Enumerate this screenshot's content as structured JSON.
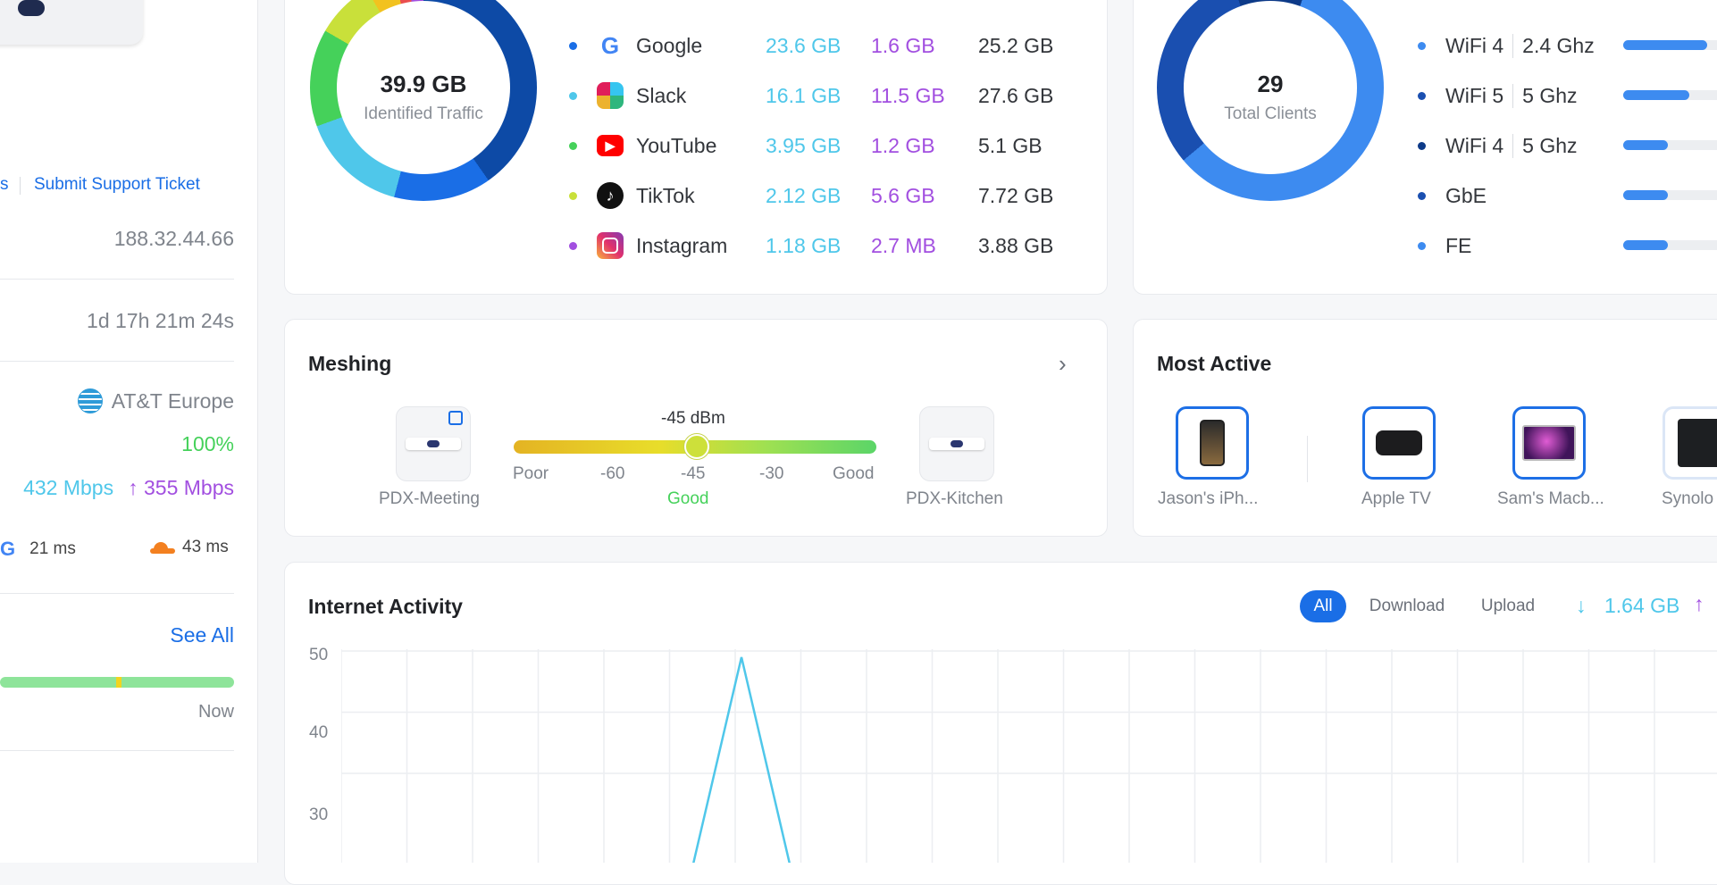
{
  "sidebar": {
    "links": {
      "fragment": "s",
      "support": "Submit Support Ticket"
    },
    "ip": "188.32.44.66",
    "uptime": "1d 17h 21m 24s",
    "isp": "AT&T Europe",
    "health": "100%",
    "download": "432 Mbps",
    "upload": "355 Mbps",
    "latency_google": "21 ms",
    "latency_cloudflare": "43 ms",
    "see_all": "See All",
    "timeline_end": "Now",
    "colors": {
      "link": "#1a6ee6",
      "health": "#45d15a",
      "download": "#4fc7ea",
      "upload": "#a24fe0"
    }
  },
  "apps": {
    "donut_value": "39.9 GB",
    "donut_caption": "Identified Traffic",
    "rows": [
      {
        "name": "Google",
        "down": "23.6 GB",
        "up": "1.6 GB",
        "total": "25.2 GB",
        "dot": "#1a6ee6",
        "icon": "google-icon"
      },
      {
        "name": "Slack",
        "down": "16.1 GB",
        "up": "11.5 GB",
        "total": "27.6 GB",
        "dot": "#4fc7ea",
        "icon": "slack-icon"
      },
      {
        "name": "YouTube",
        "down": "3.95 GB",
        "up": "1.2 GB",
        "total": "5.1 GB",
        "dot": "#45d15a",
        "icon": "youtube-icon"
      },
      {
        "name": "TikTok",
        "down": "2.12 GB",
        "up": "5.6 GB",
        "total": "7.72 GB",
        "dot": "#c9e03a",
        "icon": "tiktok-icon"
      },
      {
        "name": "Instagram",
        "down": "1.18 GB",
        "up": "2.7 MB",
        "total": "3.88 GB",
        "dot": "#a24fe0",
        "icon": "instagram-icon"
      }
    ]
  },
  "clients": {
    "donut_value": "29",
    "donut_caption": "Total Clients",
    "rows": [
      {
        "type": "WiFi 4",
        "band": "2.4 Ghz",
        "level": 0.78,
        "dot": "#3d8bf0"
      },
      {
        "type": "WiFi 5",
        "band": "5 Ghz",
        "level": 0.62,
        "dot": "#1a4fb0"
      },
      {
        "type": "WiFi 4",
        "band": "5 Ghz",
        "level": 0.42,
        "dot": "#0d3a88"
      },
      {
        "type": "GbE",
        "band": "",
        "level": 0.42,
        "dot": "#1a4fb0"
      },
      {
        "type": "FE",
        "band": "",
        "level": 0.42,
        "dot": "#3d8bf0"
      }
    ]
  },
  "meshing": {
    "title": "Meshing",
    "signal": "-45 dBm",
    "left_node": "PDX-Meeting",
    "right_node": "PDX-Kitchen",
    "scale": [
      "Poor",
      "-60",
      "-45",
      "-30",
      "Good"
    ],
    "quality": "Good",
    "level": 0.5
  },
  "most_active": {
    "title": "Most Active",
    "clients": [
      {
        "name": "Jason's iPh...",
        "icon": "iphone-icon"
      },
      {
        "name": "Apple TV",
        "icon": "apple-tv-icon"
      },
      {
        "name": "Sam's Macb...",
        "icon": "macbook-icon"
      },
      {
        "name": "Synolo",
        "icon": "nas-icon"
      }
    ]
  },
  "activity": {
    "title": "Internet Activity",
    "filters": [
      "All",
      "Download",
      "Upload"
    ],
    "active_filter": "All",
    "download_total": "1.64 GB",
    "download_arrow": "↓",
    "upload_arrow": "↑",
    "upload_arrow_label": "↑"
  },
  "chart_data": {
    "type": "line",
    "yticks": [
      "50",
      "40",
      "30"
    ],
    "ylim": [
      20,
      50
    ],
    "grid": true,
    "series": [
      {
        "values": [
          0,
          0,
          0,
          0,
          0,
          0,
          0,
          0,
          49,
          0,
          0,
          0,
          0,
          0,
          0,
          0,
          0,
          0,
          0,
          0,
          0,
          0,
          0,
          0,
          0,
          0
        ],
        "color": "#4fc7ea"
      }
    ]
  }
}
